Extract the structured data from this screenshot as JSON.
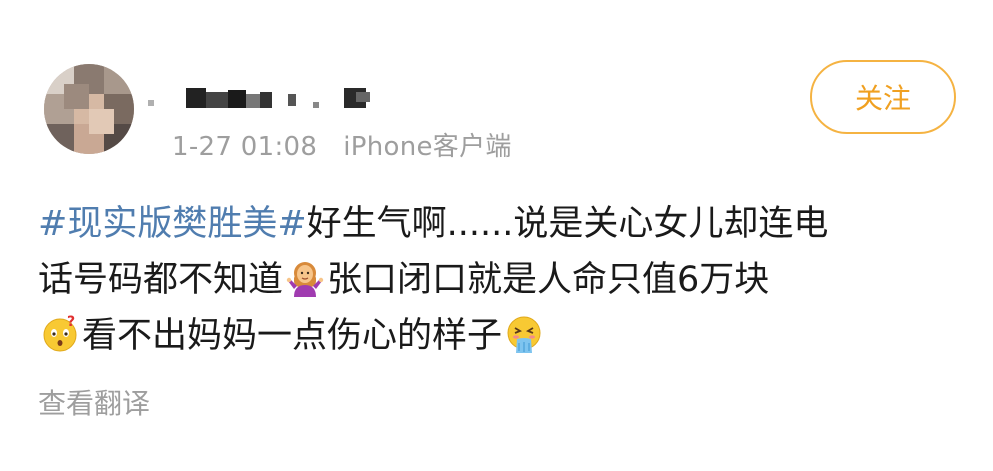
{
  "post": {
    "time": "1-27 01:08",
    "source": "iPhone客户端",
    "follow_label": "关注",
    "content": {
      "hashtag": "#现实版樊胜美#",
      "line1_text": "好生气啊......说是关心女儿却连电",
      "line2_text_a": "话号码都不知道",
      "line2_text_b": "张口闭口就是人命只值6万块",
      "line3_text": "看不出妈妈一点伤心的样子"
    },
    "translate_label": "查看翻译"
  },
  "icons": {
    "emoji_1": "shrugging-woman-emoji",
    "emoji_2": "confused-face-question-emoji",
    "emoji_3": "vomiting-face-emoji"
  },
  "colors": {
    "hashtag": "#507daf",
    "follow_accent": "#f0a020",
    "meta_text": "#9e9e9e"
  }
}
